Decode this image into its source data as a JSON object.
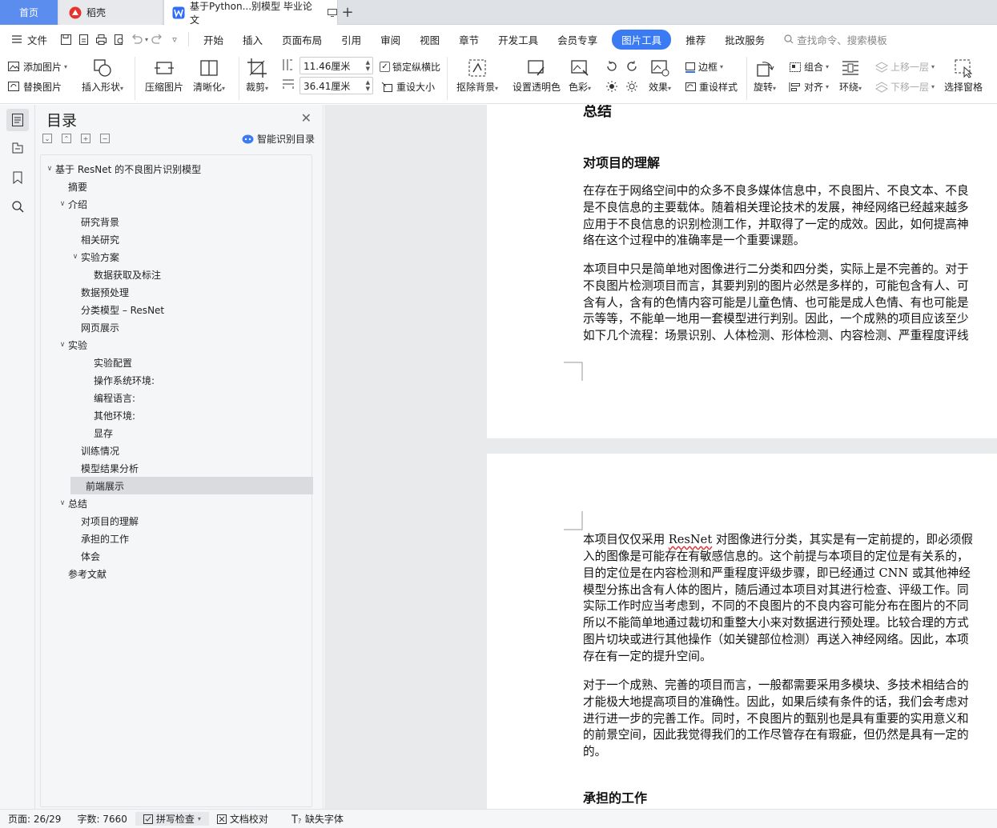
{
  "tabs": {
    "home": "首页",
    "daoke": "稻壳",
    "doc": "基于Python...别模型 毕业论文"
  },
  "menubar": {
    "file": "文件",
    "items": [
      "开始",
      "插入",
      "页面布局",
      "引用",
      "审阅",
      "视图",
      "章节",
      "开发工具",
      "会员专享"
    ],
    "active": "图片工具",
    "items_after": [
      "推荐",
      "批改服务"
    ],
    "search": "查找命令、搜索模板"
  },
  "ribbon": {
    "add_image": "添加图片",
    "replace_image": "替换图片",
    "insert_shape": "插入形状",
    "compress": "压缩图片",
    "clarity": "清晰化",
    "crop": "裁剪",
    "height": "11.46厘米",
    "width": "36.41厘米",
    "lock_ratio": "锁定纵横比",
    "reset_size": "重设大小",
    "remove_bg": "抠除背景",
    "set_transparent": "设置透明色",
    "color": "色彩",
    "effect": "效果",
    "border": "边框",
    "reset_style": "重设样式",
    "rotate": "旋转",
    "group": "组合",
    "align": "对齐",
    "wrap": "环绕",
    "bring_forward": "上移一层",
    "send_backward": "下移一层",
    "selection_pane": "选择窗格"
  },
  "toc": {
    "title": "目录",
    "smart": "智能识别目录",
    "items": [
      {
        "label": "基于 ResNet 的不良图片识别模型",
        "level": 0,
        "caret": "v"
      },
      {
        "label": "摘要",
        "level": 1,
        "caret": ""
      },
      {
        "label": "介绍",
        "level": 1,
        "caret": "v"
      },
      {
        "label": "研究背景",
        "level": 2,
        "caret": ""
      },
      {
        "label": "相关研究",
        "level": 2,
        "caret": ""
      },
      {
        "label": "实验方案",
        "level": 2,
        "caret": "v"
      },
      {
        "label": "数据获取及标注",
        "level": 3,
        "caret": ""
      },
      {
        "label": "数据预处理",
        "level": 2,
        "caret": ""
      },
      {
        "label": "分类模型 – ResNet",
        "level": 2,
        "caret": ""
      },
      {
        "label": "网页展示",
        "level": 2,
        "caret": ""
      },
      {
        "label": "实验",
        "level": 1,
        "caret": "v"
      },
      {
        "label": "实验配置",
        "level": 3,
        "caret": ""
      },
      {
        "label": "操作系统环境:",
        "level": 3,
        "caret": ""
      },
      {
        "label": "编程语言:",
        "level": 3,
        "caret": ""
      },
      {
        "label": "其他环境:",
        "level": 3,
        "caret": ""
      },
      {
        "label": "显存",
        "level": 3,
        "caret": ""
      },
      {
        "label": "训练情况",
        "level": 2,
        "caret": ""
      },
      {
        "label": "模型结果分析",
        "level": 2,
        "caret": ""
      },
      {
        "label": "前端展示",
        "level": 2,
        "caret": "",
        "selected": true
      },
      {
        "label": "总结",
        "level": 1,
        "caret": "v"
      },
      {
        "label": "对项目的理解",
        "level": 2,
        "caret": ""
      },
      {
        "label": "承担的工作",
        "level": 2,
        "caret": ""
      },
      {
        "label": "体会",
        "level": 2,
        "caret": ""
      },
      {
        "label": "参考文献",
        "level": 1,
        "caret": ""
      }
    ]
  },
  "doc": {
    "page1_top_heading": "总结",
    "page1_heading": "对项目的理解",
    "p1": [
      "在存在于网络空间中的众多不良多媒体信息中，不良图片、不良文本、不良",
      "是不良信息的主要载体。随着相关理论技术的发展，神经网络已经越来越多",
      "应用于不良信息的识别检测工作，并取得了一定的成效。因此，如何提高神",
      "络在这个过程中的准确率是一个重要课题。"
    ],
    "p2": [
      "本项目中只是简单地对图像进行二分类和四分类，实际上是不完善的。对于",
      "不良图片检测项目而言，其要判别的图片必然是多样的，可能包含有人、可",
      "含有人，含有的色情内容可能是儿童色情、也可能是成人色情、有也可能是",
      "示等等，不能单一地用一套模型进行判别。因此，一个成熟的项目应该至少",
      "如下几个流程：场景识别、人体检测、形体检测、内容检测、严重程度评线"
    ],
    "p3_first_pre": "本项目仅仅采用 ",
    "p3_first_word": "ResNet",
    "p3_first_post": " 对图像进行分类，其实是有一定前提的，即必须假",
    "p3": [
      "入的图像是可能存在有敏感信息的。这个前提与本项目的定位是有关系的，",
      "目的定位是在内容检测和严重程度评级步骤，即已经通过  CNN 或其他神经",
      "模型分拣出含有人体的图片，随后通过本项目对其进行检查、评级工作。同",
      "实际工作时应当考虑到，不同的不良图片的不良内容可能分布在图片的不同",
      "所以不能简单地通过裁切和重整大小来对数据进行预处理。比较合理的方式",
      "图片切块或进行其他操作（如关键部位检测）再送入神经网络。因此，本项",
      "存在有一定的提升空间。"
    ],
    "p4": [
      "对于一个成熟、完善的项目而言，一般都需要采用多模块、多技术相结合的",
      "才能极大地提高项目的准确性。因此，如果后续有条件的话，我们会考虑对",
      "进行进一步的完善工作。同时，不良图片的甄别也是具有重要的实用意义和",
      "的前景空间，因此我觉得我们的工作尽管存在有瑕疵，但仍然是具有一定的",
      "的。"
    ],
    "page2_heading": "承担的工作"
  },
  "status": {
    "page": "页面: 26/29",
    "words": "字数: 7660",
    "spell": "拼写检查",
    "proof": "文档校对",
    "missing_font": "缺失字体"
  }
}
